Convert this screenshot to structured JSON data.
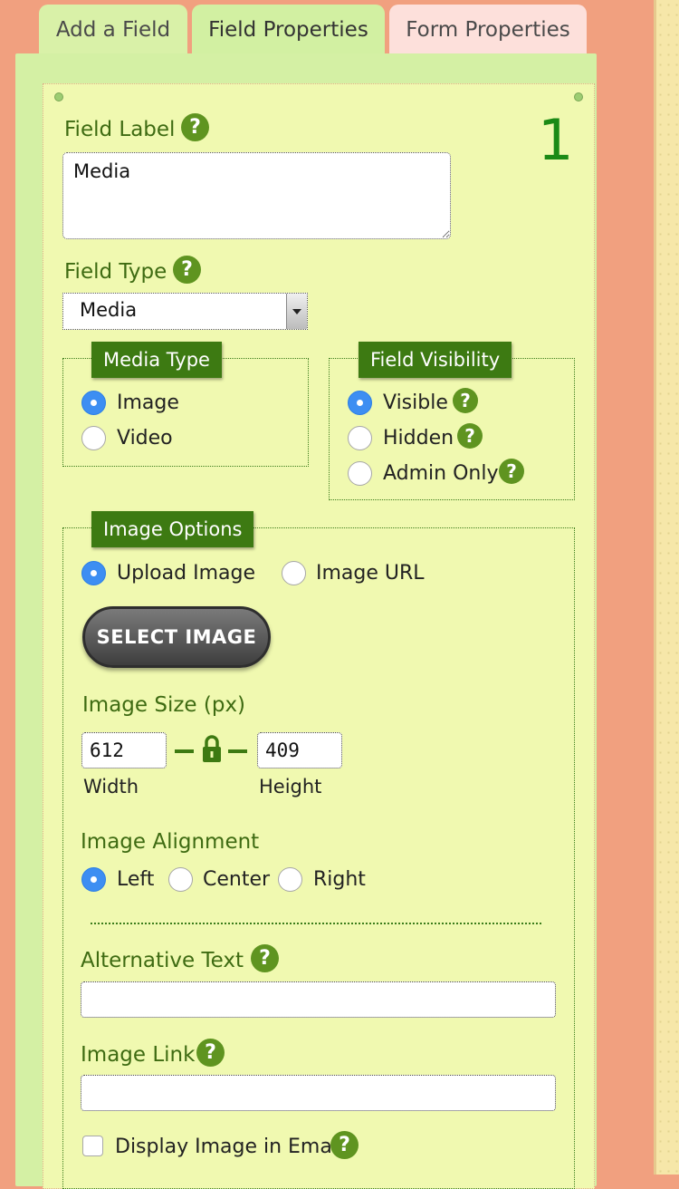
{
  "tabs": [
    {
      "label": "Add a Field"
    },
    {
      "label": "Field Properties"
    },
    {
      "label": "Form Properties"
    }
  ],
  "field_number": "1",
  "field_label": {
    "label": "Field Label",
    "help": "?",
    "value": "Media"
  },
  "field_type": {
    "label": "Field Type",
    "help": "?",
    "selected": "Media"
  },
  "media_type": {
    "legend": "Media Type",
    "options": [
      {
        "label": "Image",
        "checked": true
      },
      {
        "label": "Video",
        "checked": false
      }
    ]
  },
  "field_visibility": {
    "legend": "Field Visibility",
    "options": [
      {
        "label": "Visible",
        "checked": true,
        "help": "?"
      },
      {
        "label": "Hidden",
        "checked": false,
        "help": "?"
      },
      {
        "label": "Admin Only",
        "checked": false,
        "help": "?"
      }
    ]
  },
  "image_options": {
    "legend": "Image Options",
    "source": [
      {
        "label": "Upload Image",
        "checked": true
      },
      {
        "label": "Image URL",
        "checked": false
      }
    ],
    "select_button": "SELECT IMAGE",
    "size_label": "Image Size (px)",
    "width": {
      "value": "612",
      "label": "Width"
    },
    "height": {
      "value": "409",
      "label": "Height"
    },
    "alignment_label": "Image Alignment",
    "alignment": [
      {
        "label": "Left",
        "checked": true
      },
      {
        "label": "Center",
        "checked": false
      },
      {
        "label": "Right",
        "checked": false
      }
    ],
    "alt_text": {
      "label": "Alternative Text",
      "help": "?",
      "value": ""
    },
    "image_link": {
      "label": "Image Link",
      "help": "?",
      "value": ""
    },
    "display_in_email": {
      "label": "Display Image in Email",
      "help": "?",
      "checked": false
    }
  },
  "colors": {
    "page_bg": "#f1a07f",
    "panel_bg": "#d4f0a4",
    "inner_bg": "#f0f9b0",
    "legend_bg": "#3d7a12",
    "label_text": "#3e6b12",
    "radio_on": "#3d8ef2",
    "field_number": "#1b8a16"
  },
  "icons": {
    "help": "question-mark-circle",
    "lock": "lock-icon",
    "dropdown": "chevron-down-icon"
  }
}
